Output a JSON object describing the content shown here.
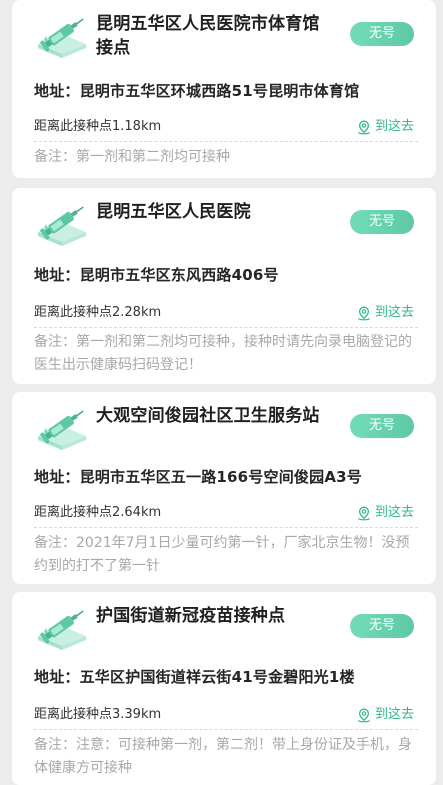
{
  "sites": [
    {
      "title": "昆明五华区人民医院市体育馆接点",
      "badge": "无号",
      "address": "地址：昆明市五华区环城西路51号昆明市体育馆",
      "distance": "距离此接种点1.18km",
      "goto_label": "到这去",
      "note": "备注：第一剂和第二剂均可接种"
    },
    {
      "title": "昆明五华区人民医院",
      "badge": "无号",
      "address": "地址：昆明市五华区东风西路406号",
      "distance": "距离此接种点2.28km",
      "goto_label": "到这去",
      "note": "备注：第一剂和第二剂均可接种，接种时请先向录电脑登记的医生出示健康码扫码登记！"
    },
    {
      "title": "大观空间俊园社区卫生服务站",
      "badge": "无号",
      "address": "地址：昆明市五华区五一路166号空间俊园A3号",
      "distance": "距离此接种点2.64km",
      "goto_label": "到这去",
      "note": "备注：2021年7月1日少量可约第一针，厂家北京生物！没预约到的打不了第一针"
    },
    {
      "title": "护国街道新冠疫苗接种点",
      "badge": "无号",
      "address": "地址：五华区护国街道祥云街41号金碧阳光1楼",
      "distance": "距离此接种点3.39km",
      "goto_label": "到这去",
      "note": "备注：注意：可接种第一剂，第二剂！带上身份证及手机，身体健康方可接种"
    }
  ],
  "colors": {
    "accent": "#2fb98a",
    "badge": "#66d1ab",
    "note": "#a8a8a8",
    "background": "#ececec"
  },
  "icons": {
    "site": "syringe-icon",
    "navigate": "location-pin-icon"
  }
}
